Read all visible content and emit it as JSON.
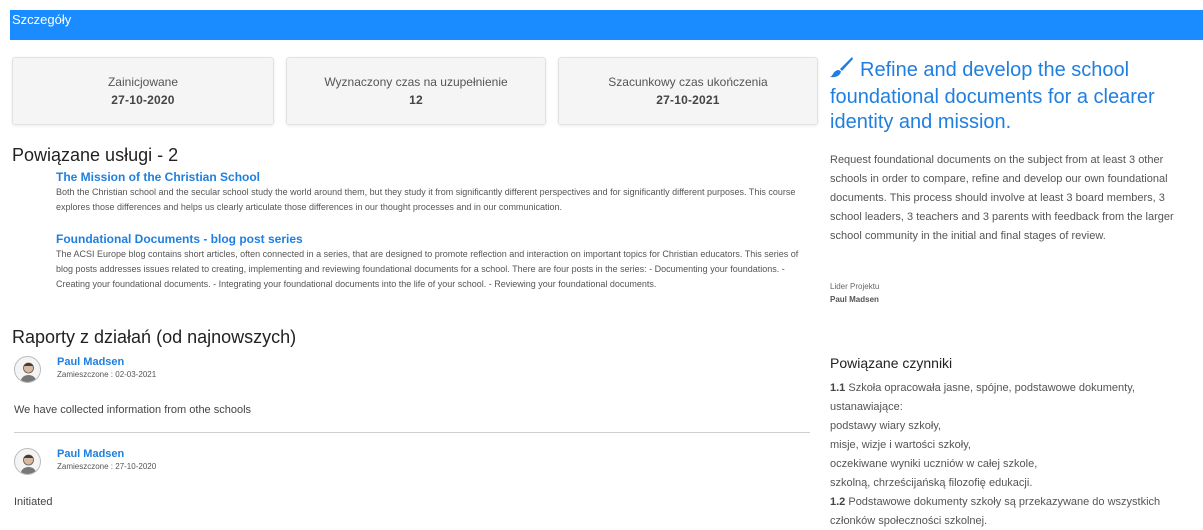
{
  "header": {
    "title": "Szczegóły"
  },
  "stats": [
    {
      "label": "Zainicjowane",
      "value": "27-10-2020"
    },
    {
      "label": "Wyznaczony czas na uzupełnienie",
      "value": "12"
    },
    {
      "label": "Szacunkowy czas ukończenia",
      "value": "27-10-2021"
    }
  ],
  "services": {
    "heading": "Powiązane usługi - 2",
    "items": [
      {
        "title": "The Mission of the Christian School",
        "description": "Both the Christian school and the secular school study the world around them, but they study it from significantly different perspectives and for significantly different purposes. This course explores those differences and helps us clearly articulate those differences in our thought processes and in our communication."
      },
      {
        "title": "Foundational Documents - blog post series",
        "description": "The ACSI Europe blog contains short articles, often connected in a series, that are designed to promote reflection and interaction on important topics for Christian educators. This series of blog posts addresses issues related to creating, implementing and reviewing foundational documents for a school. There are four posts in the series: - Documenting your foundations. - Creating your foundational documents. - Integrating your foundational documents into the life of your school. - Reviewing your foundational documents."
      }
    ]
  },
  "reports": {
    "heading": "Raporty z działań (od najnowszych)",
    "items": [
      {
        "author": "Paul Madsen",
        "posted": "Zamieszczone : 02-03-2021",
        "message": "We have collected information from othe schools"
      },
      {
        "author": "Paul Madsen",
        "posted": "Zamieszczone : 27-10-2020",
        "message": "Initiated"
      }
    ]
  },
  "goal": {
    "title_lines": [
      "Refine and develop the school",
      "foundational documents for a clearer",
      "identity and mission."
    ],
    "description_lines": [
      "Request foundational documents on the subject from at least 3 other",
      "schools in order to compare, refine and develop our own foundational",
      "documents. This process should involve at least 3 board members, 3",
      "school leaders, 3 teachers and 3 parents with feedback from the larger",
      "school community in the initial and final stages of review."
    ],
    "leader_label": "Lider Projektu",
    "leader_name": "Paul Madsen"
  },
  "factors": {
    "heading": "Powiązane czynniki",
    "num_1": "1.1",
    "line_1a": " Szkoła opracowała jasne, spójne, podstawowe dokumenty,",
    "line_1b": "ustanawiające:",
    "line_1c": "podstawy wiary szkoły,",
    "line_1d": "misje, wizje i wartości szkoły,",
    "line_1e": "oczekiwane wyniki uczniów w całej szkole,",
    "line_1f": "szkolną, chrześcijańską filozofię edukacji.",
    "num_2": "1.2",
    "line_2a": " Podstawowe dokumenty szkoły są przekazywane do wszystkich",
    "line_2b": "członków społeczności szkolnej."
  },
  "colors": {
    "header_bg": "#1a8cff",
    "link": "#1f7fe0"
  }
}
